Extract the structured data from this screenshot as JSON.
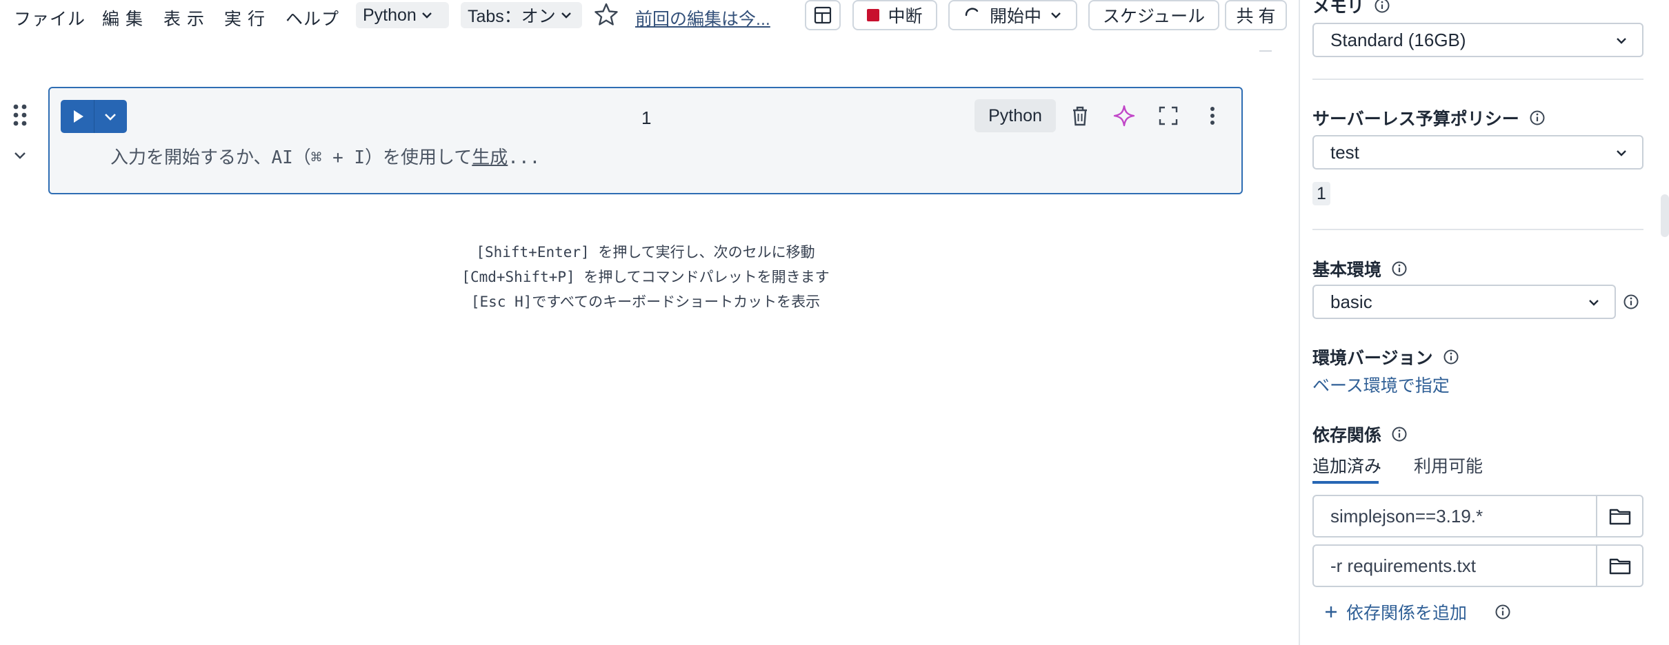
{
  "menu": {
    "file": "ファイル",
    "edit": "編 集",
    "view": "表 示",
    "run": "実 行",
    "help": "ヘルプ"
  },
  "toolbar": {
    "language": "Python",
    "tabs": "Tabs：オン",
    "last_edit": "前回の編集は今...",
    "stop_label": "中断",
    "starting_label": "開始中",
    "schedule_label": "スケジュール",
    "share_label": "共 有"
  },
  "cell": {
    "number": "1",
    "language": "Python",
    "placeholder_prefix": "入力を開始するか、AI（⌘ + I）を使用して",
    "placeholder_link": "生成",
    "placeholder_suffix": "..."
  },
  "hints": [
    "[Shift+Enter] を押して実行し、次のセルに移動",
    "[Cmd+Shift+P] を押してコマンドパレットを開きます",
    "[Esc H]ですべてのキーボードショートカットを表示"
  ],
  "panel": {
    "memory_label": "メモリ",
    "memory_value": "Standard (16GB)",
    "budget_label": "サーバーレス予算ポリシー",
    "budget_value": "test",
    "budget_count": "1",
    "base_env_label": "基本環境",
    "base_env_value": "basic",
    "env_version_label": "環境バージョン",
    "env_version_link": "ベース環境で指定",
    "deps_label": "依存関係",
    "tab_added": "追加済み",
    "tab_available": "利用可能",
    "dependencies": [
      "simplejson==3.19.*",
      "-r requirements.txt"
    ],
    "add_dependency": "依存関係を追加"
  },
  "colors": {
    "accent": "#2766b4",
    "stop_red": "#c8102e",
    "ai_sparkle": "#c146c8",
    "link": "#2f5f96"
  }
}
